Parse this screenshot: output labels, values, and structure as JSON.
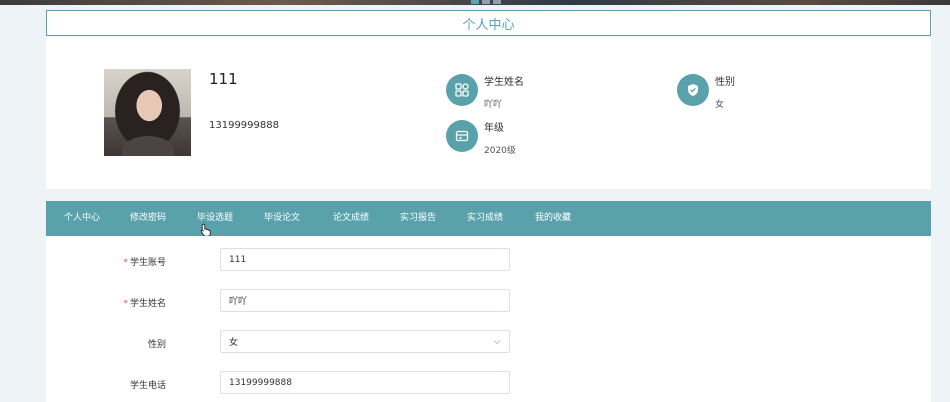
{
  "page": {
    "title": "个人中心"
  },
  "profile": {
    "username": "111",
    "phone": "13199999888",
    "fields": [
      {
        "label": "学生姓名",
        "value": "吖吖",
        "icon": "apps-icon"
      },
      {
        "label": "性别",
        "value": "女",
        "icon": "shield-check-icon"
      },
      {
        "label": "年级",
        "value": "2020级",
        "icon": "id-card-icon"
      }
    ]
  },
  "nav": {
    "items": [
      {
        "label": "个人中心"
      },
      {
        "label": "修改密码"
      },
      {
        "label": "毕设选题"
      },
      {
        "label": "毕设论文"
      },
      {
        "label": "论文成绩"
      },
      {
        "label": "实习报告"
      },
      {
        "label": "实习成绩"
      },
      {
        "label": "我的收藏"
      }
    ]
  },
  "form": {
    "account": {
      "label": "学生账号",
      "value": "111",
      "required": "*"
    },
    "name": {
      "label": "学生姓名",
      "value": "吖吖",
      "required": "*"
    },
    "gender": {
      "label": "性别",
      "value": "女"
    },
    "phone": {
      "label": "学生电话",
      "value": "13199999888"
    }
  },
  "colors": {
    "accent": "#5aa2ab",
    "required": "#e0504a"
  }
}
